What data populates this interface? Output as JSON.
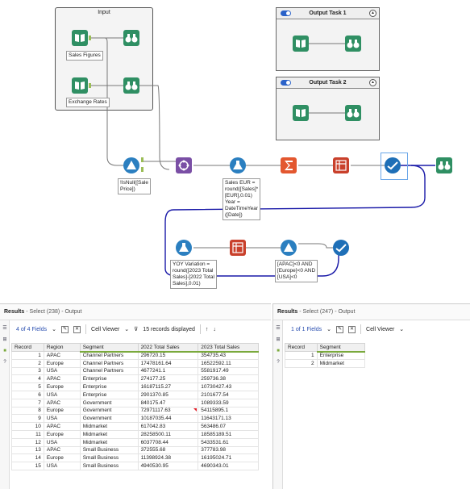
{
  "canvas": {
    "input_container_title": "Input",
    "output_task_1_title": "Output Task 1",
    "output_task_2_title": "Output Task 2",
    "labels": {
      "sales_figures": "Sales Figures",
      "exchange_rates": "Exchange Rates",
      "filter_isnull": "!IsNull([Sale\nPrice])",
      "formula_sales_eur": "Sales EUR =\nround([Sales]*\n[EUR],0.01)\nYear =\nDateTimeYear\n([Date])",
      "formula_yoy": "YOY Variation =\nround([2023 Total\nSales]-[2022 Total\nSales],0.01)",
      "filter_region": "[APAC]<0 AND\n[Europe]<0 AND\n[USA]<0"
    },
    "anchor_labels": {
      "true": "T",
      "false": "F"
    }
  },
  "colors": {
    "input_green": "#2f8f63",
    "browse_green": "#2f8f63",
    "join_purple": "#7a4fa5",
    "formula_blue": "#2b7fc0",
    "summarize_orange": "#e3572f",
    "crosstab_red": "#c9402b",
    "select_blue": "#1e6fb7",
    "wire_selected": "#1a1aa8"
  },
  "results_left": {
    "title": "Results",
    "subtitle": "- Select (238) - Output",
    "fields_label": "4 of 4 Fields",
    "cell_viewer": "Cell Viewer",
    "records_displayed": "15 records displayed",
    "columns": [
      "Record",
      "Region",
      "Segment",
      "2022 Total Sales",
      "2023 Total Sales"
    ],
    "rows": [
      [
        "1",
        "APAC",
        "Channel Partners",
        "296720.15",
        "354735.43"
      ],
      [
        "2",
        "Europe",
        "Channel Partners",
        "17478161.64",
        "16522592.11"
      ],
      [
        "3",
        "USA",
        "Channel Partners",
        "4677241.1",
        "5581917.49"
      ],
      [
        "4",
        "APAC",
        "Enterprise",
        "274177.25",
        "259736.38"
      ],
      [
        "5",
        "Europe",
        "Enterprise",
        "16187115.27",
        "10730427.43"
      ],
      [
        "6",
        "USA",
        "Enterprise",
        "2901370.85",
        "2101677.54"
      ],
      [
        "7",
        "APAC",
        "Government",
        "840175.47",
        "1089333.59"
      ],
      [
        "8",
        "Europe",
        "Government",
        "72971117.63",
        "54115895.1"
      ],
      [
        "9",
        "USA",
        "Government",
        "10187035.44",
        "11643171.13"
      ],
      [
        "10",
        "APAC",
        "Midmarket",
        "617042.83",
        "563486.07"
      ],
      [
        "11",
        "Europe",
        "Midmarket",
        "28258500.11",
        "18585189.51"
      ],
      [
        "12",
        "USA",
        "Midmarket",
        "6037708.44",
        "5433531.61"
      ],
      [
        "13",
        "APAC",
        "Small Business",
        "372555.68",
        "377783.98"
      ],
      [
        "14",
        "Europe",
        "Small Business",
        "11398924.38",
        "16195024.71"
      ],
      [
        "15",
        "USA",
        "Small Business",
        "4940530.95",
        "4690343.01"
      ]
    ]
  },
  "results_right": {
    "title": "Results",
    "subtitle": "- Select (247) - Output",
    "fields_label": "1 of 1 Fields",
    "cell_viewer": "Cell Viewer",
    "columns": [
      "Record",
      "Segment"
    ],
    "rows": [
      [
        "1",
        "Enterprise"
      ],
      [
        "2",
        "Midmarket"
      ]
    ]
  }
}
